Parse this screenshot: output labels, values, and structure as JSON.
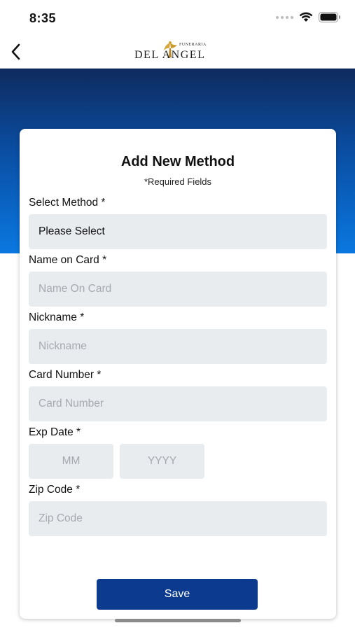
{
  "status_bar": {
    "time": "8:35"
  },
  "header": {
    "logo_top": "FUNERARIA",
    "logo_main": "DEL ANGEL"
  },
  "form": {
    "title": "Add New Method",
    "subtitle": "*Required Fields",
    "select_method": {
      "label": "Select Method *",
      "value": "Please Select"
    },
    "name_on_card": {
      "label": "Name on Card *",
      "placeholder": "Name On Card"
    },
    "nickname": {
      "label": "Nickname *",
      "placeholder": "Nickname"
    },
    "card_number": {
      "label": "Card Number *",
      "placeholder": "Card Number"
    },
    "exp_date": {
      "label": "Exp Date *",
      "month_placeholder": "MM",
      "year_placeholder": "YYYY"
    },
    "zip_code": {
      "label": "Zip Code *",
      "placeholder": "Zip Code"
    },
    "save_label": "Save"
  },
  "colors": {
    "primary": "#0c3a8e",
    "field_bg": "#e9ecef",
    "hero_top": "#0e2b5e",
    "hero_bottom": "#0a78e0"
  }
}
